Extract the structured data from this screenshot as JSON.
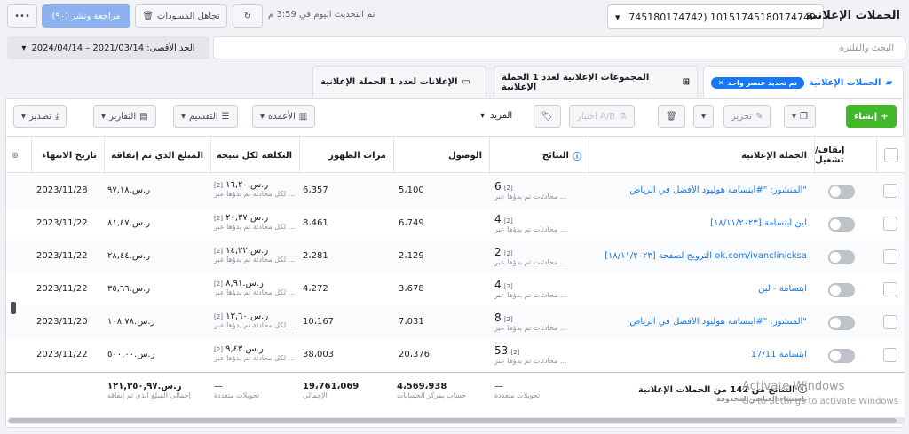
{
  "header": {
    "title": "الحملات الإعلانية",
    "account_selector": "745180174742) 10151745180174742",
    "updated": "تم التحديث اليوم في 3:59 م",
    "discard_drafts": "تجاهل المسودات",
    "review_publish": "مراجعة ونشر (٩٠)",
    "more": "•••"
  },
  "search": {
    "placeholder": "البحث والفلترة"
  },
  "date_range": {
    "label": "الحد الأقصى: 2021/03/14 – 2024/04/14"
  },
  "tabs": [
    {
      "label": "الحملات الإعلانية",
      "chip": "تم تحديد عنصر واحد"
    },
    {
      "label": "المجموعات الإعلانية لعدد 1 الحملة الإعلانية"
    },
    {
      "label": "الإعلانات لعدد 1 الحملة الإعلانية"
    }
  ],
  "toolbar": {
    "create": "إنشاء",
    "edit": "تحرير",
    "ab_test": "اختبار A/B",
    "more": "المزيد",
    "columns": "الأعمدة",
    "breakdown": "التقسيم",
    "reports": "التقارير",
    "export": "تصدير"
  },
  "columns": {
    "onoff": "إيقاف/ تشغيل",
    "campaign": "الحملة الإعلانية",
    "results": "النتائج",
    "reach": "الوصول",
    "impressions": "مرات الظهور",
    "cost_per_result": "التكلفة لكل نتيجة",
    "amount_spent": "المبلغ الذي تم إنفاقه",
    "end_date": "تاريخ الانتهاء"
  },
  "rows": [
    {
      "campaign": "المنشور: \"#ابتسامة هوليود الأفضل في الرياض\"",
      "results": "6",
      "results_sub": "محادثات تم بدؤها عبر ...",
      "reach": "5،100",
      "impressions": "6،357",
      "cost": "ر.س.١٦,٢٠",
      "cost_sub": "لكل محادثة تم بدؤها عبر ...",
      "spent": "ر.س.٩٧,١٨",
      "end": "2023/11/28"
    },
    {
      "campaign": "[١٨/١١/٢٠٢٣] لين ابتسامة",
      "results": "4",
      "results_sub": "محادثات تم بدؤها عبر ...",
      "reach": "6،749",
      "impressions": "8،461",
      "cost": "ر.س.٢٠,٣٧",
      "cost_sub": "لكل محادثة تم بدؤها عبر ...",
      "spent": "ر.س.٨١,٤٧",
      "end": "2023/11/22"
    },
    {
      "campaign": "[١٨/١١/٢٠٢٣] الترويج لصفحة ok.com/ivanclinicksa",
      "results": "2",
      "results_sub": "محادثات تم بدؤها عبر ...",
      "reach": "2،129",
      "impressions": "2،281",
      "cost": "ر.س.١٤,٢٢",
      "cost_sub": "لكل محادثة تم بدؤها عبر ...",
      "spent": "ر.س.٢٨,٤٤",
      "end": "2023/11/22"
    },
    {
      "campaign": "ابتسامة - لين",
      "results": "4",
      "results_sub": "محادثات تم بدؤها عبر ...",
      "reach": "3،678",
      "impressions": "4،272",
      "cost": "ر.س.٨,٩١",
      "cost_sub": "لكل محادثة تم بدؤها عبر ...",
      "spent": "ر.س.٣٥,٦٦",
      "end": "2023/11/22"
    },
    {
      "campaign": "المنشور: \"#ابتسامة هوليود الأفضل في الرياض\"",
      "results": "8",
      "results_sub": "محادثات تم بدؤها عبر ...",
      "reach": "7،031",
      "impressions": "10،167",
      "cost": "ر.س.١٣,٦٠",
      "cost_sub": "لكل محادثة تم بدؤها عبر ...",
      "spent": "ر.س.١٠٨,٧٨",
      "end": "2023/11/20"
    },
    {
      "campaign": "ابتسامة 17/11",
      "results": "53",
      "results_sub": "محادثات تم بدؤها عبر ...",
      "reach": "20،376",
      "impressions": "38،003",
      "cost": "ر.س.٩,٤٣",
      "cost_sub": "لكل محادثة تم بدؤها عبر ...",
      "spent": "ر.س.٥٠٠,٠٠",
      "end": "2023/11/22"
    }
  ],
  "totals": {
    "campaign": "النتائج من 142 من الحملات الإعلانية",
    "campaign_sub": "باستثناء العناصر المحذوفة",
    "results": "—",
    "results_sub": "تحويلات متعددة",
    "reach": "4،569،938",
    "reach_sub": "حساب بمركز الحسابات",
    "impressions": "19،761،069",
    "impressions_sub": "الإجمالي",
    "cost": "—",
    "cost_sub": "تحويلات متعددة",
    "spent": "ر.س.١٢١,٣٥٠,٩٧",
    "spent_sub": "إجمالي المبلغ الذي تم إنفاقه"
  },
  "watermark": {
    "title": "Activate Windows",
    "sub": "Go to Settings to activate Windows"
  },
  "colors": {
    "primary": "#1877f2",
    "create": "#42b72a"
  }
}
